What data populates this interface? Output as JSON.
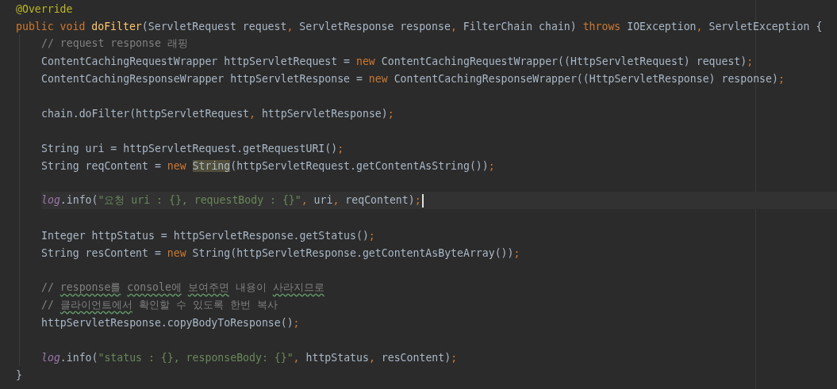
{
  "editor": {
    "lines": [
      {
        "kind": "code",
        "tokens": [
          {
            "text": "@Override",
            "kind": "annotation"
          }
        ]
      },
      {
        "kind": "code",
        "tokens": [
          {
            "text": "public void ",
            "kind": "keyword"
          },
          {
            "text": "doFilter",
            "kind": "method"
          },
          {
            "text": "(ServletRequest request",
            "kind": "plain"
          },
          {
            "text": ",",
            "kind": "punct"
          },
          {
            "text": " ServletResponse response",
            "kind": "plain"
          },
          {
            "text": ",",
            "kind": "punct"
          },
          {
            "text": " FilterChain chain) ",
            "kind": "plain"
          },
          {
            "text": "throws",
            "kind": "keyword"
          },
          {
            "text": " IOException",
            "kind": "plain"
          },
          {
            "text": ",",
            "kind": "punct"
          },
          {
            "text": " ServletException {",
            "kind": "plain"
          }
        ],
        "children": [
          {
            "kind": "code",
            "tokens": [
              {
                "text": "// request response 래핑",
                "kind": "comment"
              }
            ]
          },
          {
            "kind": "code",
            "tokens": [
              {
                "text": "ContentCachingRequestWrapper httpServletRequest = ",
                "kind": "plain"
              },
              {
                "text": "new",
                "kind": "keyword"
              },
              {
                "text": " ContentCachingRequestWrapper((HttpServletRequest) request)",
                "kind": "plain"
              },
              {
                "text": ";",
                "kind": "punct"
              }
            ]
          },
          {
            "kind": "code",
            "tokens": [
              {
                "text": "ContentCachingResponseWrapper httpServletResponse = ",
                "kind": "plain"
              },
              {
                "text": "new",
                "kind": "keyword"
              },
              {
                "text": " ContentCachingResponseWrapper((HttpServletResponse) response)",
                "kind": "plain"
              },
              {
                "text": ";",
                "kind": "punct"
              }
            ]
          },
          {
            "kind": "blank"
          },
          {
            "kind": "code",
            "tokens": [
              {
                "text": "chain.doFilter(httpServletRequest",
                "kind": "plain"
              },
              {
                "text": ",",
                "kind": "punct"
              },
              {
                "text": " httpServletResponse)",
                "kind": "plain"
              },
              {
                "text": ";",
                "kind": "punct"
              }
            ]
          },
          {
            "kind": "blank"
          },
          {
            "kind": "code",
            "tokens": [
              {
                "text": "String uri = httpServletRequest.getRequestURI()",
                "kind": "plain"
              },
              {
                "text": ";",
                "kind": "punct"
              }
            ]
          },
          {
            "kind": "code",
            "tokens": [
              {
                "text": "String reqContent = ",
                "kind": "plain"
              },
              {
                "text": "new ",
                "kind": "keyword"
              },
              {
                "text": "String",
                "kind": "plain",
                "highlighted": true
              },
              {
                "text": "(httpServletRequest.getContentAsString())",
                "kind": "plain"
              },
              {
                "text": ";",
                "kind": "punct"
              }
            ]
          },
          {
            "kind": "blank"
          },
          {
            "kind": "code",
            "current": true,
            "tokens": [
              {
                "text": "log",
                "kind": "field"
              },
              {
                "text": ".info(",
                "kind": "plain"
              },
              {
                "text": "\"요청 uri : {}, requestBody : {}\"",
                "kind": "string"
              },
              {
                "text": ",",
                "kind": "punct"
              },
              {
                "text": " uri",
                "kind": "plain"
              },
              {
                "text": ",",
                "kind": "punct"
              },
              {
                "text": " reqContent)",
                "kind": "plain"
              },
              {
                "text": ";",
                "kind": "punct"
              }
            ]
          },
          {
            "kind": "blank"
          },
          {
            "kind": "code",
            "tokens": [
              {
                "text": "Integer httpStatus = httpServletResponse.getStatus()",
                "kind": "plain"
              },
              {
                "text": ";",
                "kind": "punct"
              }
            ]
          },
          {
            "kind": "code",
            "tokens": [
              {
                "text": "String resContent = ",
                "kind": "plain"
              },
              {
                "text": "new",
                "kind": "keyword"
              },
              {
                "text": " String(httpServletResponse.getContentAsByteArray())",
                "kind": "plain"
              },
              {
                "text": ";",
                "kind": "punct"
              }
            ]
          },
          {
            "kind": "blank"
          },
          {
            "kind": "code",
            "tokens": [
              {
                "text": "// ",
                "kind": "comment"
              },
              {
                "text": "response를",
                "kind": "comment",
                "typo": true
              },
              {
                "text": " console에",
                "kind": "comment",
                "typo": true
              },
              {
                "text": " 보여주면",
                "kind": "comment",
                "typo": true
              },
              {
                "text": " 내용이 ",
                "kind": "comment"
              },
              {
                "text": "사라지므로",
                "kind": "comment",
                "typo": true
              }
            ]
          },
          {
            "kind": "code",
            "tokens": [
              {
                "text": "// ",
                "kind": "comment"
              },
              {
                "text": "클라이언트에서",
                "kind": "comment",
                "typo": true
              },
              {
                "text": " 확인할 수 있도록 한번 복사",
                "kind": "comment"
              }
            ]
          },
          {
            "kind": "code",
            "tokens": [
              {
                "text": "httpServletResponse.copyBodyToResponse()",
                "kind": "plain"
              },
              {
                "text": ";",
                "kind": "punct"
              }
            ]
          },
          {
            "kind": "blank"
          },
          {
            "kind": "code",
            "tokens": [
              {
                "text": "log",
                "kind": "field"
              },
              {
                "text": ".info(",
                "kind": "plain"
              },
              {
                "text": "\"status : {}, responseBody: {}\"",
                "kind": "string"
              },
              {
                "text": ",",
                "kind": "punct"
              },
              {
                "text": " httpStatus",
                "kind": "plain"
              },
              {
                "text": ",",
                "kind": "punct"
              },
              {
                "text": " resContent)",
                "kind": "plain"
              },
              {
                "text": ";",
                "kind": "punct"
              }
            ]
          }
        ]
      },
      {
        "kind": "code",
        "tokens": [
          {
            "text": "}",
            "kind": "plain"
          }
        ]
      }
    ]
  }
}
